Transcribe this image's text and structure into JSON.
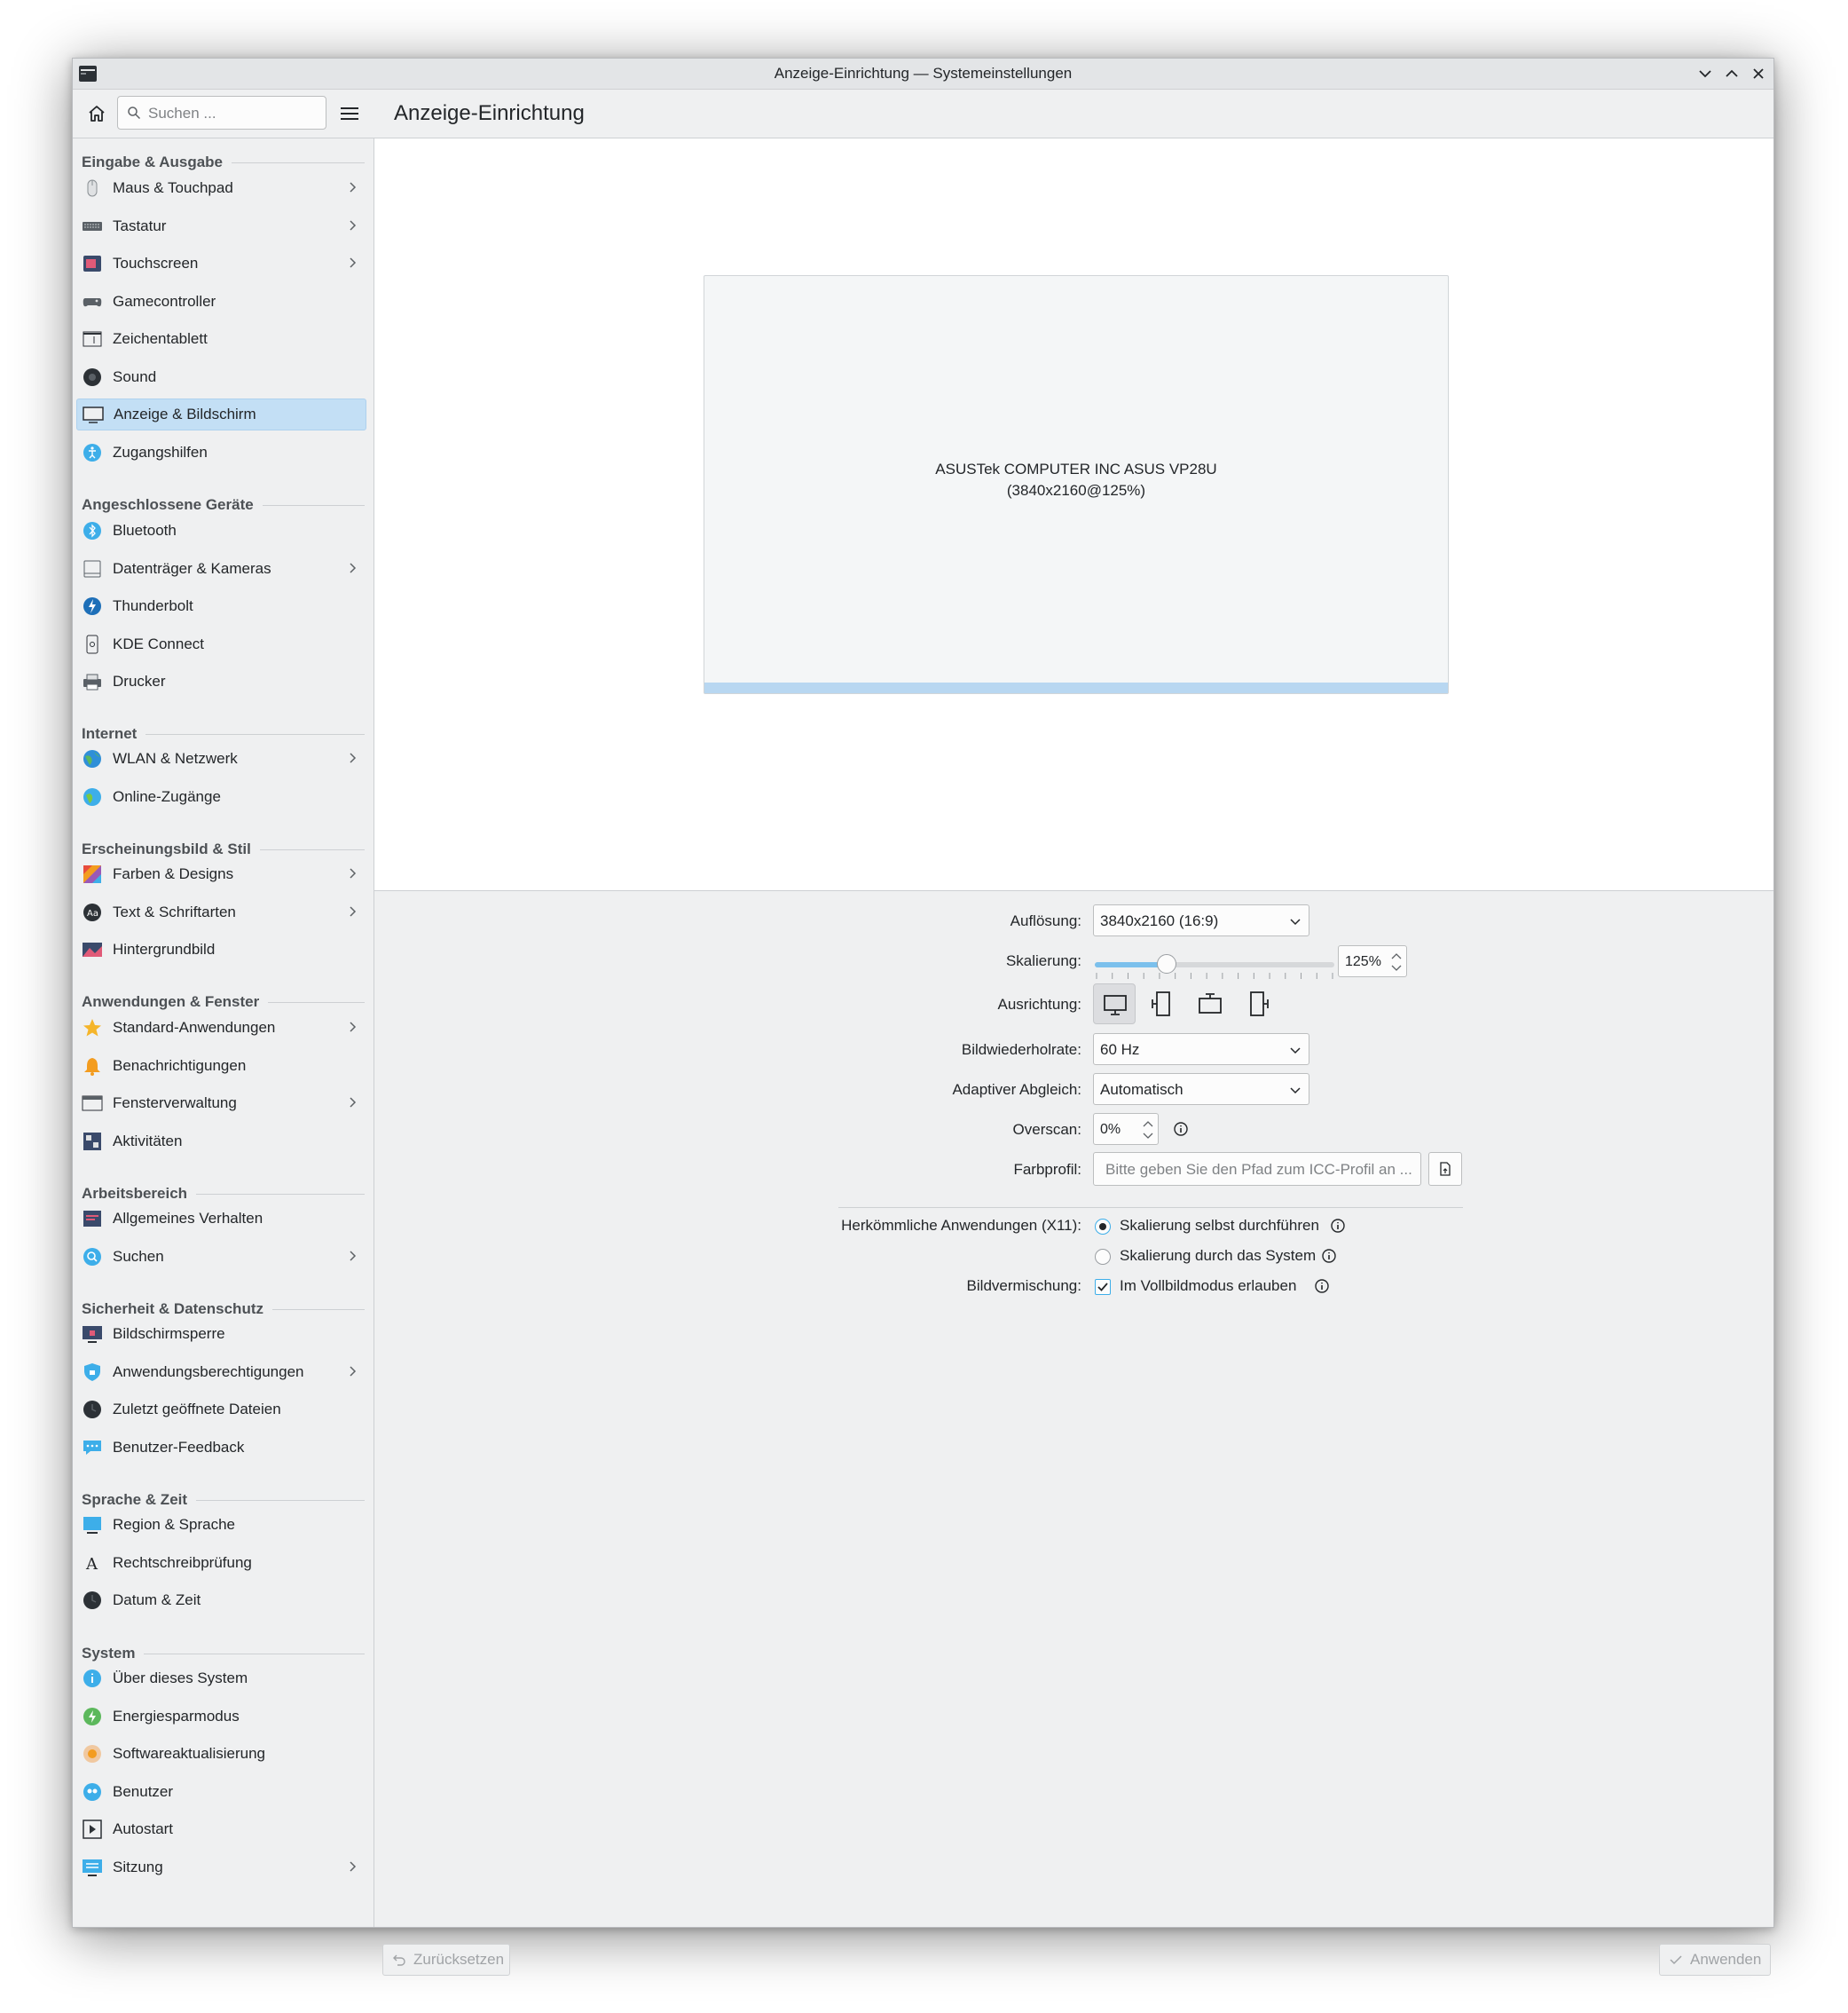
{
  "window": {
    "title": "Anzeige-Einrichtung — Systemeinstellungen"
  },
  "header": {
    "search_placeholder": "Suchen ...",
    "page_title": "Anzeige-Einrichtung"
  },
  "sidebar": {
    "sections": [
      {
        "title": "Eingabe & Ausgabe"
      },
      {
        "title": "Angeschlossene Geräte"
      },
      {
        "title": "Internet"
      },
      {
        "title": "Erscheinungsbild & Stil"
      },
      {
        "title": "Anwendungen & Fenster"
      },
      {
        "title": "Arbeitsbereich"
      },
      {
        "title": "Sicherheit & Datenschutz"
      },
      {
        "title": "Sprache & Zeit"
      },
      {
        "title": "System"
      }
    ],
    "items": [
      {
        "label": "Maus & Touchpad",
        "icon": "mouse-icon",
        "has_sub": true
      },
      {
        "label": "Tastatur",
        "icon": "keyboard-icon",
        "has_sub": true
      },
      {
        "label": "Touchscreen",
        "icon": "touchscreen-icon",
        "has_sub": true
      },
      {
        "label": "Gamecontroller",
        "icon": "gamepad-icon",
        "has_sub": false
      },
      {
        "label": "Zeichentablett",
        "icon": "tablet-icon",
        "has_sub": false
      },
      {
        "label": "Sound",
        "icon": "speaker-icon",
        "has_sub": false
      },
      {
        "label": "Anzeige & Bildschirm",
        "icon": "display-icon",
        "has_sub": false,
        "active": true
      },
      {
        "label": "Zugangshilfen",
        "icon": "accessibility-icon",
        "has_sub": false
      },
      {
        "label": "Bluetooth",
        "icon": "bluetooth-icon",
        "has_sub": false
      },
      {
        "label": "Datenträger & Kameras",
        "icon": "drive-icon",
        "has_sub": true
      },
      {
        "label": "Thunderbolt",
        "icon": "thunderbolt-icon",
        "has_sub": false
      },
      {
        "label": "KDE Connect",
        "icon": "phone-icon",
        "has_sub": false
      },
      {
        "label": "Drucker",
        "icon": "printer-icon",
        "has_sub": false
      },
      {
        "label": "WLAN & Netzwerk",
        "icon": "network-globe-icon",
        "has_sub": true
      },
      {
        "label": "Online-Zugänge",
        "icon": "online-accounts-icon",
        "has_sub": false
      },
      {
        "label": "Farben & Designs",
        "icon": "colors-icon",
        "has_sub": true
      },
      {
        "label": "Text & Schriftarten",
        "icon": "fonts-icon",
        "has_sub": true
      },
      {
        "label": "Hintergrundbild",
        "icon": "wallpaper-icon",
        "has_sub": false
      },
      {
        "label": "Standard-Anwendungen",
        "icon": "star-icon",
        "has_sub": true
      },
      {
        "label": "Benachrichtigungen",
        "icon": "bell-icon",
        "has_sub": false
      },
      {
        "label": "Fensterverwaltung",
        "icon": "window-icon",
        "has_sub": true
      },
      {
        "label": "Aktivitäten",
        "icon": "activities-icon",
        "has_sub": false
      },
      {
        "label": "Allgemeines Verhalten",
        "icon": "general-behavior-icon",
        "has_sub": false
      },
      {
        "label": "Suchen",
        "icon": "search-icon",
        "has_sub": true
      },
      {
        "label": "Bildschirmsperre",
        "icon": "screen-lock-icon",
        "has_sub": false
      },
      {
        "label": "Anwendungsberechtigungen",
        "icon": "shield-icon",
        "has_sub": true
      },
      {
        "label": "Zuletzt geöffnete Dateien",
        "icon": "clock-icon",
        "has_sub": false
      },
      {
        "label": "Benutzer-Feedback",
        "icon": "feedback-icon",
        "has_sub": false
      },
      {
        "label": "Region & Sprache",
        "icon": "region-icon",
        "has_sub": false
      },
      {
        "label": "Rechtschreibprüfung",
        "icon": "spellcheck-icon",
        "has_sub": false
      },
      {
        "label": "Datum & Zeit",
        "icon": "clock-icon",
        "has_sub": false
      },
      {
        "label": "Über dieses System",
        "icon": "info-icon",
        "has_sub": false
      },
      {
        "label": "Energiesparmodus",
        "icon": "power-icon",
        "has_sub": false
      },
      {
        "label": "Softwareaktualisierung",
        "icon": "update-icon",
        "has_sub": false
      },
      {
        "label": "Benutzer",
        "icon": "users-icon",
        "has_sub": false
      },
      {
        "label": "Autostart",
        "icon": "autostart-icon",
        "has_sub": false
      },
      {
        "label": "Sitzung",
        "icon": "session-icon",
        "has_sub": true
      }
    ]
  },
  "preview": {
    "monitor_name": "ASUSTek COMPUTER INC ASUS VP28U",
    "monitor_mode": "(3840x2160@125%)"
  },
  "form": {
    "resolution_label": "Auflösung:",
    "resolution_value": "3840x2160 (16:9)",
    "scaling_label": "Skalierung:",
    "scaling_value": "125%",
    "scaling_fraction": 0.3,
    "orientation_label": "Ausrichtung:",
    "refresh_label": "Bildwiederholrate:",
    "refresh_value": "60 Hz",
    "adaptive_label": "Adaptiver Abgleich:",
    "adaptive_value": "Automatisch",
    "overscan_label": "Overscan:",
    "overscan_value": "0%",
    "color_profile_label": "Farbprofil:",
    "color_profile_placeholder": "Bitte geben Sie den Pfad zum ICC-Profil an ...",
    "legacy_label": "Herkömmliche Anwendungen (X11):",
    "legacy_option1": "Skalierung selbst durchführen",
    "legacy_option2": "Skalierung durch das System",
    "tearing_label": "Bildvermischung:",
    "tearing_option": "Im Vollbildmodus erlauben"
  },
  "footer": {
    "reset_label": "Zurücksetzen",
    "apply_label": "Anwenden"
  },
  "colors": {
    "accent": "#3daee9",
    "selection": "#c3dff5"
  }
}
